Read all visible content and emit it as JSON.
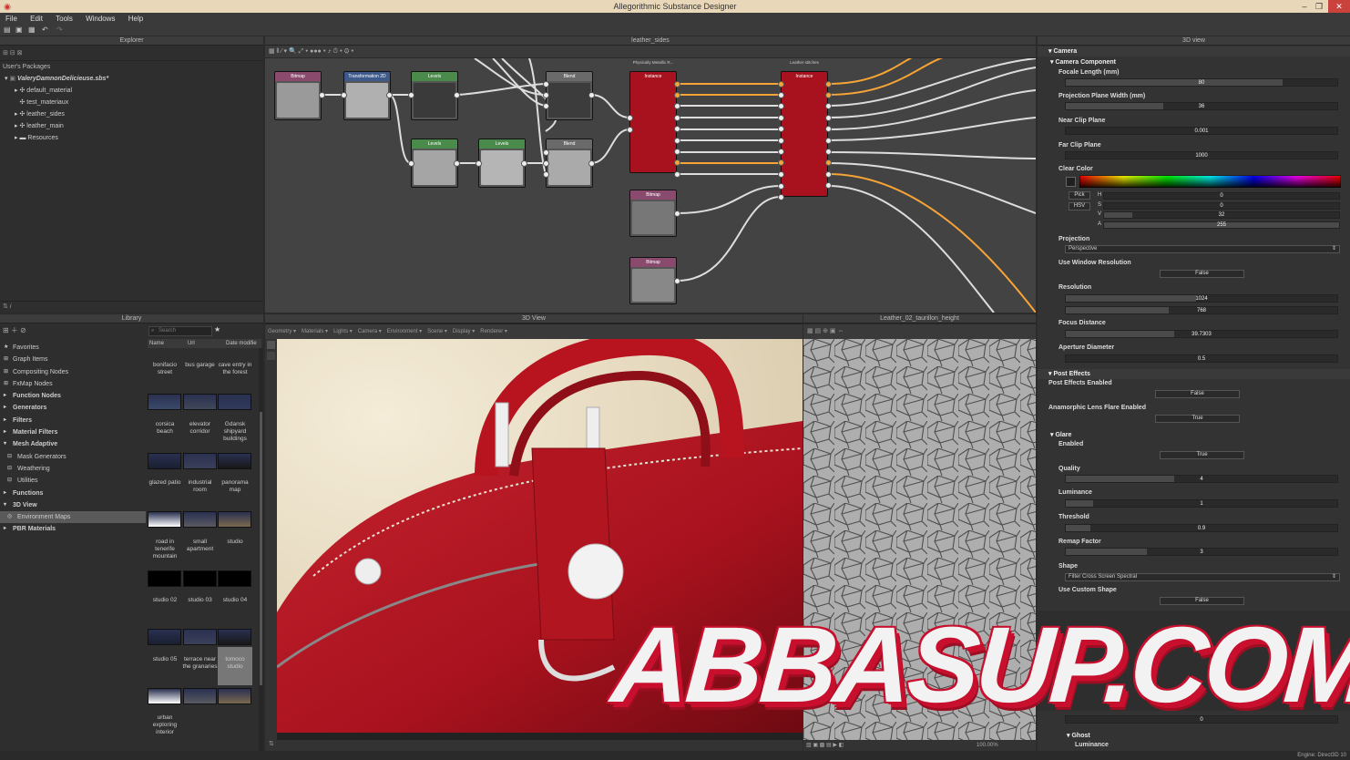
{
  "window": {
    "title": "Allegorithmic Substance Designer"
  },
  "menu": [
    "File",
    "Edit",
    "Tools",
    "Windows",
    "Help"
  ],
  "explorer": {
    "title": "Explorer",
    "root_label": "User's Packages",
    "package": "ValeryDamnonDelicieuse.sbs*",
    "items": [
      "default_material",
      "test_materiaux",
      "leather_sides",
      "leather_main",
      "Resources"
    ]
  },
  "graph": {
    "title": "leather_sides",
    "nodes": [
      {
        "label": "Bitmap",
        "color": "#8a4a6e"
      },
      {
        "label": "Transformation 2D",
        "color": "#3d5a8a"
      },
      {
        "label": "Levels",
        "color": "#4a8a4a"
      },
      {
        "label": "Blend",
        "color": "#6a6a6a"
      },
      {
        "label": "Levels",
        "color": "#4a8a4a"
      },
      {
        "label": "Levels",
        "color": "#4a8a4a"
      },
      {
        "label": "Blend",
        "color": "#6a6a6a"
      },
      {
        "label": "Instance",
        "color": "#a8121e"
      },
      {
        "label": "Instance",
        "color": "#a8121e"
      },
      {
        "label": "Bitmap",
        "color": "#8a4a6e"
      },
      {
        "label": "Bitmap",
        "color": "#8a4a6e"
      }
    ],
    "instance_captions": [
      "Physically Metallic R...",
      "Leather stitches"
    ]
  },
  "properties": {
    "title": "3D view",
    "camera": "Camera",
    "camera_component": "Camera Component",
    "focal_length": {
      "label": "Focale Length (mm)",
      "value": "80",
      "fill": 0.8
    },
    "projection_width": {
      "label": "Projection Plane Width (mm)",
      "value": "36",
      "fill": 0.36
    },
    "near_clip": {
      "label": "Near Clip Plane",
      "value": "0.001",
      "fill": 0.0
    },
    "far_clip": {
      "label": "Far Clip Plane",
      "value": "1000",
      "fill": 0.0
    },
    "clear_color": {
      "label": "Clear Color",
      "pick": "Pick",
      "hsv": "HSV",
      "channels": [
        "H",
        "S",
        "V",
        "A"
      ],
      "values": [
        "0",
        "0",
        "32",
        "255"
      ]
    },
    "projection": {
      "label": "Projection",
      "value": "Perspective"
    },
    "use_window_resolution": {
      "label": "Use Window Resolution",
      "value": "False"
    },
    "resolution": {
      "label": "Resolution",
      "w": "1024",
      "h": "768"
    },
    "focus_distance": {
      "label": "Focus Distance",
      "value": "39.7303",
      "fill": 0.4
    },
    "aperture": {
      "label": "Aperture Diameter",
      "value": "0.5",
      "fill": 0.0
    },
    "post_effects": "Post Effects",
    "post_effects_enabled": {
      "label": "Post Effects Enabled",
      "value": "False"
    },
    "anamorphic": {
      "label": "Anamorphic Lens Flare Enabled",
      "value": "True"
    },
    "glare": "Glare",
    "glare_enabled": {
      "label": "Enabled",
      "value": "True"
    },
    "quality": {
      "label": "Quality",
      "value": "4",
      "fill": 0.4
    },
    "luminance": {
      "label": "Luminance",
      "value": "1",
      "fill": 0.1
    },
    "threshold": {
      "label": "Threshold",
      "value": "0.9",
      "fill": 0.09
    },
    "remap": {
      "label": "Remap Factor",
      "value": "3",
      "fill": 0.3
    },
    "shape": {
      "label": "Shape",
      "value": "Filter Cross Screen Spectral"
    },
    "use_custom_shape": {
      "label": "Use Custom Shape",
      "value": "False"
    },
    "ghost": "Ghost",
    "ghost_luminance": "Luminance",
    "ghost_value": "0"
  },
  "library": {
    "title": "Library",
    "search_placeholder": "Search",
    "columns": [
      "Name",
      "Url",
      "Date modifie"
    ],
    "categories": [
      {
        "label": "Favorites",
        "bold": false
      },
      {
        "label": "Graph Items",
        "bold": false
      },
      {
        "label": "Compositing Nodes",
        "bold": false
      },
      {
        "label": "FxMap Nodes",
        "bold": false
      },
      {
        "label": "Function Nodes",
        "bold": true
      },
      {
        "label": "Generators",
        "bold": true
      },
      {
        "label": "Filters",
        "bold": true
      },
      {
        "label": "Material Filters",
        "bold": true
      },
      {
        "label": "Mesh Adaptive",
        "bold": true
      },
      {
        "label": "Mask Generators",
        "bold": false
      },
      {
        "label": "Weathering",
        "bold": false
      },
      {
        "label": "Utilities",
        "bold": false
      },
      {
        "label": "Functions",
        "bold": true
      },
      {
        "label": "3D View",
        "bold": true
      },
      {
        "label": "Environment Maps",
        "bold": false
      },
      {
        "label": "PBR Materials",
        "bold": true
      }
    ],
    "tiles": [
      "bonifacio street",
      "bus garage",
      "cave entry in the forest",
      "corsica beach",
      "elevator corridor",
      "Gdansk shipyard buildings",
      "glazed patio",
      "industrial room",
      "panorama map",
      "road in tenerife mountain",
      "small apartment",
      "studio",
      "studio 02",
      "studio 03",
      "studio 04",
      "studio 05",
      "terrace near the granaries",
      "tomoco studio",
      "urban exploring interior"
    ]
  },
  "view3d": {
    "title": "3D View",
    "menus": [
      "Geometry",
      "Materials",
      "Lights",
      "Camera",
      "Environment",
      "Scene",
      "Display",
      "Renderer"
    ]
  },
  "view2d": {
    "title": "Leather_02_taurillon_height",
    "zoom": "100.00%"
  },
  "status": {
    "engine": "Engine: Direct3D 10"
  },
  "watermark": "ABBASUP.COM"
}
